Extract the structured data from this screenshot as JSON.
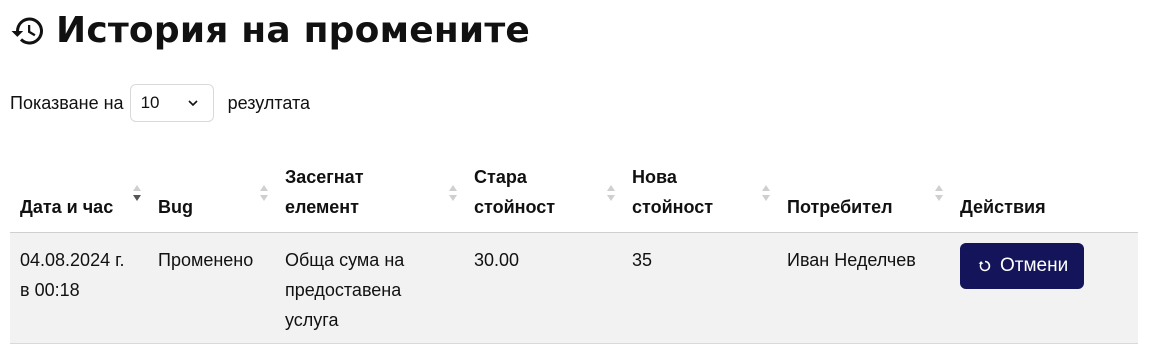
{
  "header": {
    "title": "История на промените",
    "icon": "history-icon"
  },
  "length": {
    "prefix": "Показване на",
    "value": "10",
    "suffix": "резултата"
  },
  "table": {
    "columns": [
      {
        "label": "Дата и час",
        "sort": "desc"
      },
      {
        "label": "Bug",
        "sort": "none"
      },
      {
        "label": "Засегнат елемент",
        "sort": "none"
      },
      {
        "label": "Стара стойност",
        "sort": "none"
      },
      {
        "label": "Нова стойност",
        "sort": "none"
      },
      {
        "label": "Потребител",
        "sort": "none"
      },
      {
        "label": "Действия",
        "sort": ""
      }
    ],
    "rows": [
      {
        "date": "04.08.2024 г. в 00:18",
        "bug": "Променено",
        "element": "Обща сума на предоставена услуга",
        "old_value": "30.00",
        "new_value": "35",
        "user": "Иван Неделчев",
        "action_label": "Отмени"
      }
    ]
  },
  "colors": {
    "button_bg": "#14145a",
    "row_bg": "#f2f2f2"
  }
}
